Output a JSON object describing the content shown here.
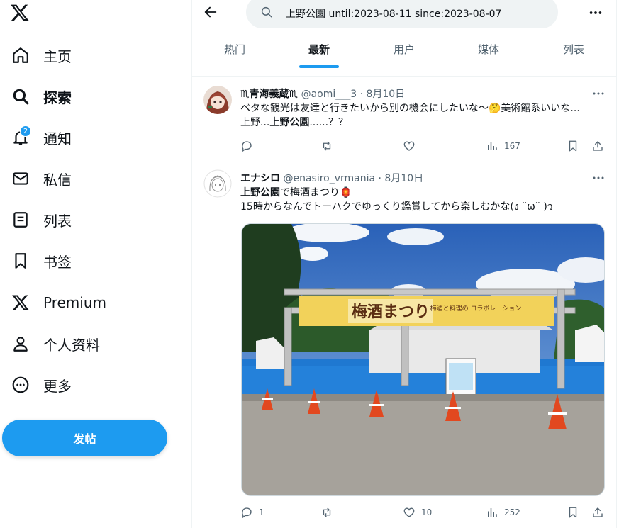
{
  "sidebar": {
    "logo_icon": "x-logo-icon",
    "items": [
      {
        "label": "主页",
        "icon": "home-icon"
      },
      {
        "label": "探索",
        "icon": "search-icon",
        "active": true
      },
      {
        "label": "通知",
        "icon": "bell-icon",
        "badge": "2"
      },
      {
        "label": "私信",
        "icon": "mail-icon"
      },
      {
        "label": "列表",
        "icon": "list-icon"
      },
      {
        "label": "书签",
        "icon": "bookmark-icon"
      },
      {
        "label": "Premium",
        "icon": "x-logo-icon"
      },
      {
        "label": "个人资料",
        "icon": "person-icon"
      },
      {
        "label": "更多",
        "icon": "more-circle-icon"
      }
    ],
    "post_button": "发帖"
  },
  "header": {
    "search_value": "上野公園 until:2023-08-11 since:2023-08-07",
    "tabs": [
      "热门",
      "最新",
      "用户",
      "媒体",
      "列表"
    ],
    "active_tab": "最新"
  },
  "tweets": [
    {
      "name": "♏青海義蔵♏",
      "handle": "@aomi___3 · 8月10日",
      "line1": "ベタな観光は友達と行きたいから別の機会にしたいな〜🤔美術館系いいな...",
      "line2_prefix": "上野...",
      "line2_highlight": "上野公園",
      "line2_suffix": "......？？",
      "replies": "",
      "retweets": "",
      "likes": "",
      "views": "167"
    },
    {
      "name": "エナシロ",
      "handle": "@enasiro_vrmania · 8月10日",
      "line1_highlight": "上野公園",
      "line1_suffix": "で梅酒まつり🏮",
      "line2": "15時からなんでトーハクでゆっくり鑑賞してから楽しむかな(ง ˘ω˘ )ว",
      "replies": "1",
      "retweets": "",
      "likes": "10",
      "views": "252",
      "photo_sign_main": "梅酒まつり",
      "photo_sign_right": "梅酒と料理の コラボレーション"
    }
  ],
  "colors": {
    "accent": "#1d9bf0",
    "text": "#0f1419",
    "muted": "#536471"
  }
}
